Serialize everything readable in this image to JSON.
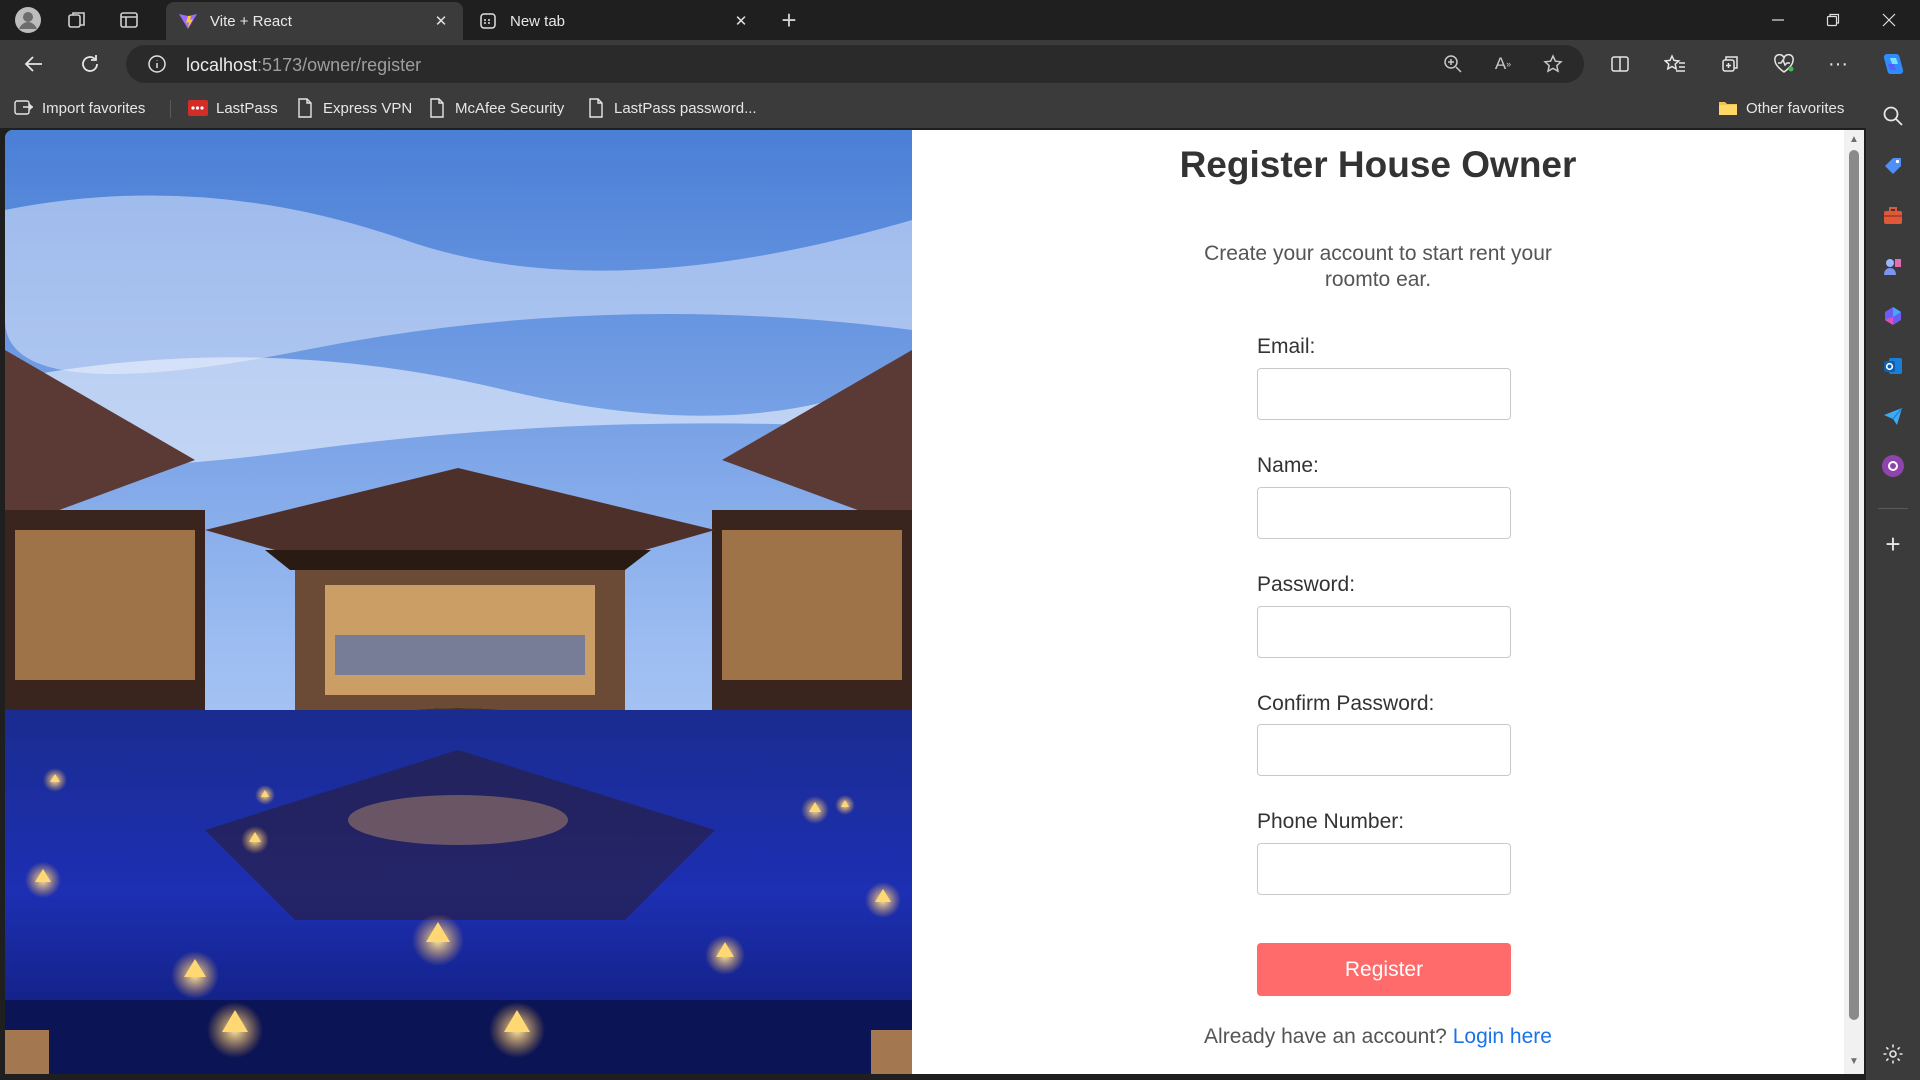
{
  "browser": {
    "tabs": [
      {
        "title": "Vite + React",
        "active": true
      },
      {
        "title": "New tab",
        "active": false
      }
    ],
    "address": {
      "host": "localhost",
      "path": ":5173/owner/register"
    },
    "favorites": [
      {
        "label": "Import favorites",
        "icon": "import-icon"
      },
      {
        "label": "LastPass",
        "icon": "lastpass-icon"
      },
      {
        "label": "Express VPN",
        "icon": "page-icon"
      },
      {
        "label": "McAfee Security",
        "icon": "page-icon"
      },
      {
        "label": "LastPass password...",
        "icon": "page-icon"
      }
    ],
    "other_favorites": "Other favorites"
  },
  "page": {
    "title": "Register House Owner",
    "subtitle": "Create your account to start rent your roomto ear.",
    "fields": [
      {
        "label": "Email:",
        "value": "",
        "type": "email"
      },
      {
        "label": "Name:",
        "value": "",
        "type": "text"
      },
      {
        "label": "Password:",
        "value": "",
        "type": "password"
      },
      {
        "label": "Confirm Password:",
        "value": "",
        "type": "password"
      },
      {
        "label": "Phone Number:",
        "value": "",
        "type": "tel"
      }
    ],
    "register_label": "Register",
    "login_prompt": "Already have an account?",
    "login_link": "Login here"
  },
  "colors": {
    "register_button": "#ff6b6b",
    "link": "#1a73e8",
    "browser_chrome": "#3b3b3b"
  }
}
